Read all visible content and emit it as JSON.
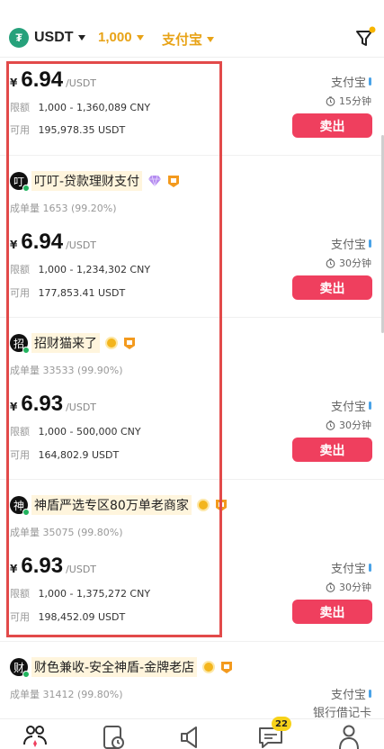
{
  "filters": {
    "coin_symbol": "₮",
    "coin": "USDT",
    "amount": "1,000",
    "payment": "支付宝"
  },
  "labels": {
    "stats_label": "成单量",
    "limit_label": "限额",
    "available_label": "可用",
    "currency_symbol": "¥",
    "price_unit": "/USDT",
    "sell": "卖出"
  },
  "offers": [
    {
      "price": "6.94",
      "limit": "1,000 - 1,360,089 CNY",
      "available": "195,978.35 USDT",
      "payment": "支付宝",
      "time": "15分钟"
    },
    {
      "avatar_char": "叮",
      "merchant": "叮叮-贷款理财支付",
      "stats": "1653 (99.20%)",
      "price": "6.94",
      "limit": "1,000 - 1,234,302 CNY",
      "available": "177,853.41 USDT",
      "payment": "支付宝",
      "time": "30分钟"
    },
    {
      "avatar_char": "招",
      "merchant": "招财猫来了",
      "stats": "33533 (99.90%)",
      "price": "6.93",
      "limit": "1,000 - 500,000 CNY",
      "available": "164,802.9 USDT",
      "payment": "支付宝",
      "time": "30分钟"
    },
    {
      "avatar_char": "神",
      "merchant": "神盾严选专区80万单老商家",
      "stats": "35075 (99.80%)",
      "price": "6.93",
      "limit": "1,000 - 1,375,272 CNY",
      "available": "198,452.09 USDT",
      "payment": "支付宝",
      "time": "30分钟"
    },
    {
      "avatar_char": "财",
      "merchant": "财色兼收-安全神盾-金牌老店",
      "stats": "31412 (99.80%)",
      "payment": "支付宝",
      "payment2": "银行借记卡"
    }
  ],
  "nav": {
    "messages_badge": "22"
  },
  "colors": {
    "accent_gold": "#e8a317",
    "sell_button": "#ef3f5e",
    "highlight_border": "#e24a4a",
    "tether_green": "#26a17b"
  }
}
